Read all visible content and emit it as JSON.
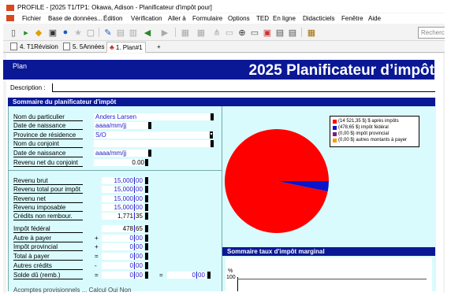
{
  "window": {
    "title": "PROFILE - [2025 T1/TP1: Okawa, Adison - Planificateur d'impôt pour]"
  },
  "menu": [
    "Fichier",
    "Base de données...",
    "Édition",
    "Vérification",
    "Aller à",
    "Formulaire",
    "Options",
    "TED",
    "En ligne",
    "Didacticiels",
    "Fenêtre",
    "Aide"
  ],
  "toolbar": {
    "icons": [
      "new-doc",
      "open-folder",
      "tax-year",
      "save",
      "info",
      "favorite",
      "search-doc",
      "edit",
      "form",
      "copy",
      "back-arrow",
      "forward-arrow",
      "grid",
      "layout",
      "tree",
      "pages",
      "zoom",
      "window",
      "screen",
      "print",
      "print-setup",
      "calculator"
    ],
    "search_placeholder": "Recherch"
  },
  "tabs": [
    {
      "label": "4. T1Révision",
      "active": false
    },
    {
      "label": "5. 5Années",
      "active": false
    },
    {
      "label": "1. Plan#1",
      "active": true
    },
    {
      "label": "+",
      "active": false
    }
  ],
  "header": {
    "plan_label": "Plan",
    "title": "2025 Planificateur d’impôt"
  },
  "description": {
    "label": "Description :",
    "value": ""
  },
  "summary": {
    "title": "Sommaire du planificateur d'impôt",
    "fields": [
      {
        "label": "Nom du particulier",
        "value": "Anders Larsen"
      },
      {
        "label": "Date de naissance",
        "value": "aaaa/mm/jj"
      },
      {
        "label": "Province de résidence",
        "value": "S/O"
      },
      {
        "label": "Nom du conjoint",
        "value": ""
      },
      {
        "label": "Date de naissance",
        "value": "aaaa/mm/jj"
      },
      {
        "label": "Revenu net du conjoint",
        "value": "0.00"
      }
    ],
    "income_rows": [
      {
        "label": "Revenu brut",
        "op": "",
        "dollars": "15,000",
        "cents": "00"
      },
      {
        "label": "Revenu total pour impôt",
        "op": "",
        "dollars": "15,000",
        "cents": "00"
      },
      {
        "label": "Revenu net",
        "op": "",
        "dollars": "15,000",
        "cents": "00"
      },
      {
        "label": "Revenu imposable",
        "op": "",
        "dollars": "15,000",
        "cents": "00"
      },
      {
        "label": "Crédits non rembour.",
        "op": "",
        "dollars": "1,771",
        "cents": "35"
      }
    ],
    "tax_rows": [
      {
        "label": "Impôt fédéral",
        "op": "",
        "dollars": "478",
        "cents": "65"
      },
      {
        "label": "Autre à payer",
        "op": "+",
        "dollars": "0",
        "cents": "00"
      },
      {
        "label": "Impôt provincial",
        "op": "+",
        "dollars": "0",
        "cents": "00"
      },
      {
        "label": "Total à payer",
        "op": "=",
        "dollars": "0",
        "cents": "00"
      },
      {
        "label": "Autres crédits",
        "op": "-",
        "dollars": "0",
        "cents": "00"
      },
      {
        "label": "Solde dû (remb.)",
        "op": "=",
        "dollars": "0",
        "cents": "00"
      }
    ],
    "balance_extra": {
      "op": "=",
      "dollars": "0",
      "cents": "00"
    },
    "cut_row_text": "Acomptes provisionnels ... Calcul    Oui   Non"
  },
  "chart_data": {
    "type": "pie",
    "title": "",
    "slices": [
      {
        "label": "(14 521,35 $) $ après impôts",
        "value": 14521.35,
        "color": "#ff0000"
      },
      {
        "label": "(478,65 $) impôt fédéral",
        "value": 478.65,
        "color": "#0a14cc"
      },
      {
        "label": "(0,00 $) impôt provincial",
        "value": 0,
        "color": "#7a1a8a"
      },
      {
        "label": "(0,00 $) autres montants à payer",
        "value": 0,
        "color": "#ff9900"
      }
    ],
    "legend_position": "top-right"
  },
  "marginal": {
    "title": "Sommaire taux d'impôt marginal",
    "y_label": "%",
    "y_top": "100"
  }
}
